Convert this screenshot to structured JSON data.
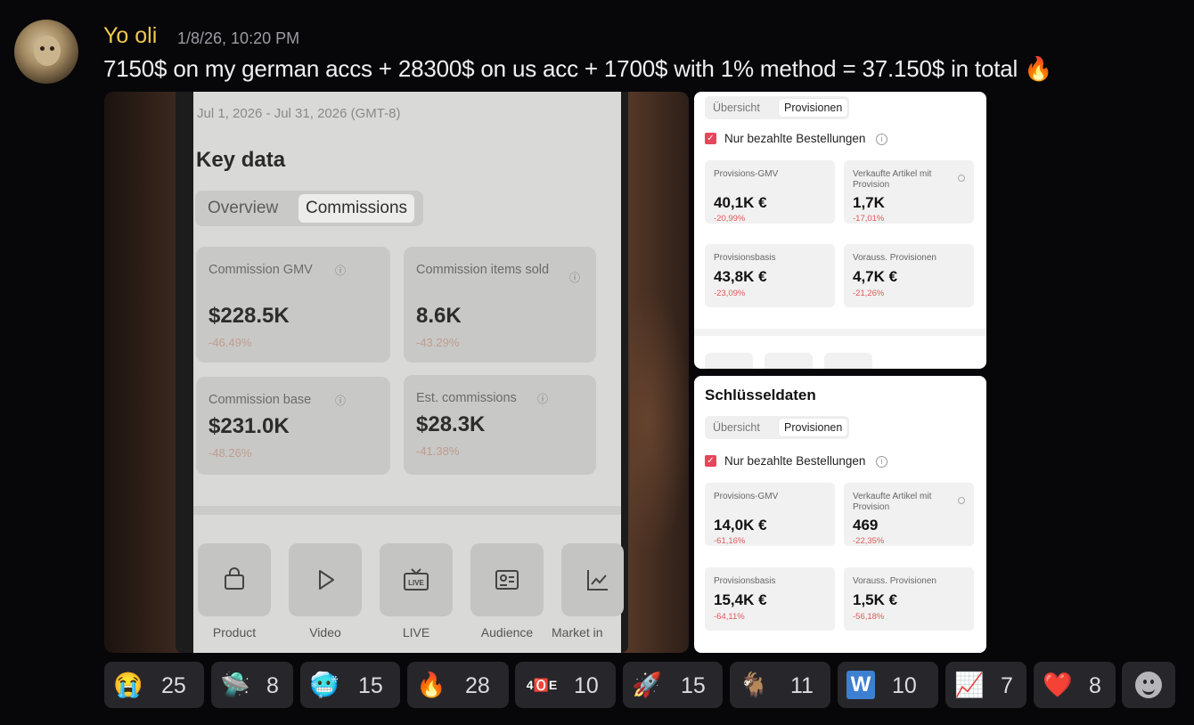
{
  "post": {
    "username": "Yo oli",
    "timestamp": "1/8/26, 10:20 PM",
    "text": "7150$ on my german accs + 28300$ on us acc + 1700$ with 1% method = 37.150$ in total",
    "trailing_emoji": "🔥"
  },
  "photo": {
    "date_range": "Jul 1, 2026 - Jul 31, 2026 (GMT-8)",
    "title": "Key data",
    "tabs": [
      "Overview",
      "Commissions"
    ],
    "active_tab": "Commissions",
    "metrics": [
      {
        "label": "Commission GMV",
        "value": "$228.5K",
        "change": "-46.49%"
      },
      {
        "label": "Commission items sold",
        "value": "8.6K",
        "change": "-43.29%"
      },
      {
        "label": "Commission base",
        "value": "$231.0K",
        "change": "-48.26%"
      },
      {
        "label": "Est. commissions",
        "value": "$28.3K",
        "change": "-41.38%"
      }
    ],
    "nav_tiles": [
      "Product",
      "Video",
      "LIVE",
      "Audience",
      "Market in"
    ]
  },
  "screenshot_top": {
    "tabs": [
      "Übersicht",
      "Provisionen"
    ],
    "active_tab": "Provisionen",
    "checkbox_label": "Nur bezahlte Bestellungen",
    "metrics": [
      {
        "label": "Provisions-GMV",
        "value": "40,1K €",
        "change": "-20,99%"
      },
      {
        "label": "Verkaufte Artikel mit Provision",
        "value": "1,7K",
        "change": "-17,01%"
      },
      {
        "label": "Provisionsbasis",
        "value": "43,8K €",
        "change": "-23,09%"
      },
      {
        "label": "Vorauss. Provisionen",
        "value": "4,7K €",
        "change": "-21,26%"
      }
    ]
  },
  "screenshot_bottom": {
    "heading": "Schlüsseldaten",
    "tabs": [
      "Übersicht",
      "Provisionen"
    ],
    "active_tab": "Provisionen",
    "checkbox_label": "Nur bezahlte Bestellungen",
    "metrics": [
      {
        "label": "Provisions-GMV",
        "value": "14,0K €",
        "change": "-61,16%"
      },
      {
        "label": "Verkaufte Artikel mit Provision",
        "value": "469",
        "change": "-22,35%"
      },
      {
        "label": "Provisionsbasis",
        "value": "15,4K €",
        "change": "-64,11%"
      },
      {
        "label": "Vorauss. Provisionen",
        "value": "1,5K €",
        "change": "-56,18%"
      }
    ]
  },
  "reactions": [
    {
      "emoji": "😭",
      "icon": "loudly-crying-face-icon",
      "count": "25"
    },
    {
      "emoji": "🛸",
      "icon": "ufo-icon",
      "count": "8"
    },
    {
      "emoji": "🥶",
      "icon": "cold-face-icon",
      "count": "15"
    },
    {
      "emoji": "🔥",
      "icon": "fire-icon",
      "count": "28"
    },
    {
      "emoji": "4🅾️E",
      "icon": "custom-40e-icon",
      "count": "10"
    },
    {
      "emoji": "🚀",
      "icon": "rocket-icon",
      "count": "15"
    },
    {
      "emoji": "🐐",
      "icon": "goat-icon",
      "count": "11"
    },
    {
      "emoji": "W",
      "icon": "w-letter-icon",
      "count": "10"
    },
    {
      "emoji": "📈",
      "icon": "chart-increasing-icon",
      "count": "7"
    },
    {
      "emoji": "❤️",
      "icon": "heart-icon",
      "count": "8"
    }
  ],
  "colors": {
    "username": "#f2c94c",
    "reaction_bg": "#27272b",
    "negative_change": "#e05a5a"
  }
}
